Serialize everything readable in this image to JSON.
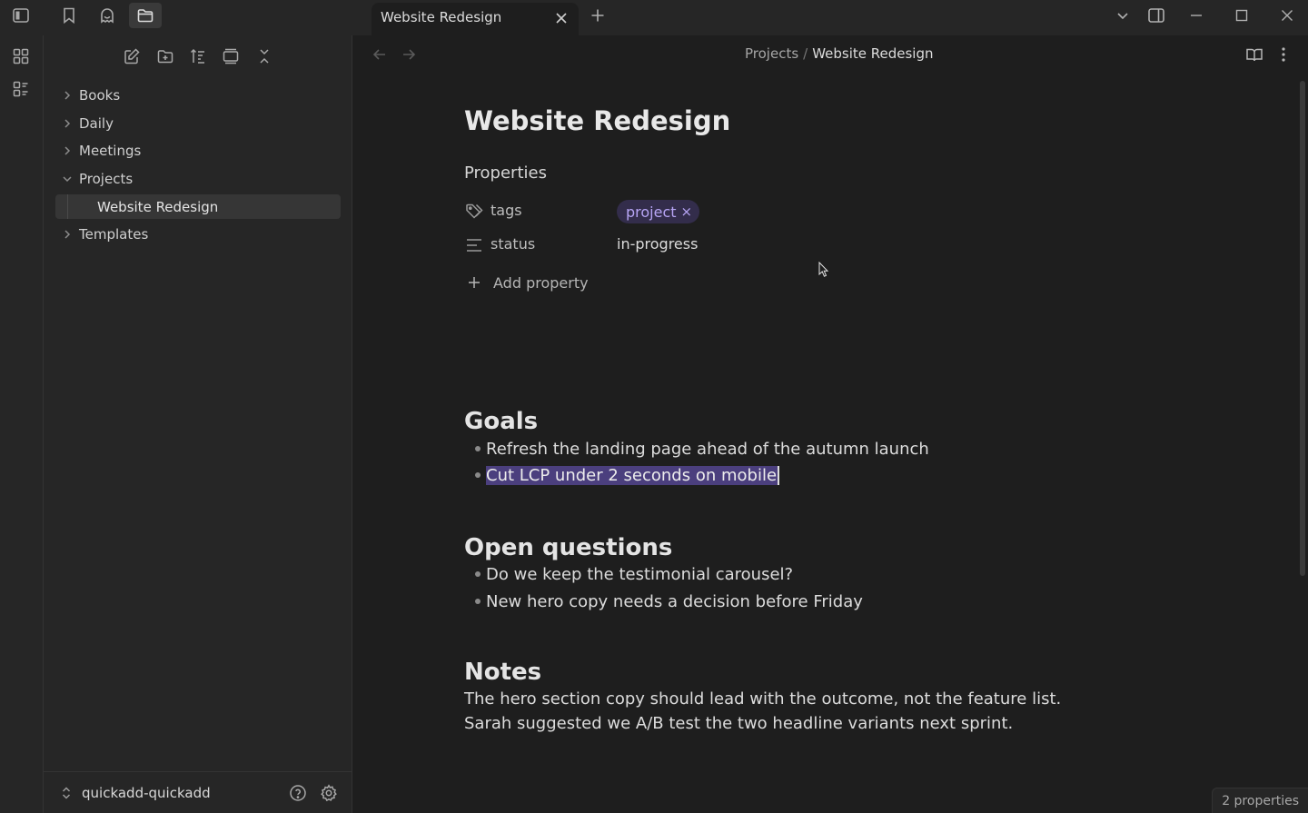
{
  "tabs": [
    {
      "label": "Website Redesign",
      "active": true
    }
  ],
  "sidebar": {
    "items": [
      {
        "label": "Books",
        "type": "folder",
        "expanded": false
      },
      {
        "label": "Daily",
        "type": "folder",
        "expanded": false
      },
      {
        "label": "Meetings",
        "type": "folder",
        "expanded": false
      },
      {
        "label": "Projects",
        "type": "folder",
        "expanded": true
      },
      {
        "label": "Website Redesign",
        "type": "file",
        "active": true
      },
      {
        "label": "Templates",
        "type": "folder",
        "expanded": false
      }
    ],
    "vault_name": "quickadd-quickadd"
  },
  "breadcrumb": {
    "parent": "Projects",
    "separator": "/",
    "current": "Website Redesign"
  },
  "note": {
    "title": "Website Redesign",
    "properties_heading": "Properties",
    "properties": [
      {
        "key": "tags",
        "icon": "tags-icon",
        "value": "project",
        "kind": "tag"
      },
      {
        "key": "status",
        "icon": "text-lines-icon",
        "value": "in-progress",
        "kind": "text"
      }
    ],
    "add_property_label": "Add property",
    "sections": {
      "goals": {
        "heading": "Goals",
        "bullets": [
          "Refresh the landing page ahead of the autumn launch",
          "Cut LCP under 2 seconds on mobile"
        ]
      },
      "questions": {
        "heading": "Open questions",
        "bullets": [
          "Do we keep the testimonial carousel?",
          "New hero copy needs a decision before Friday"
        ]
      },
      "notes": {
        "heading": "Notes",
        "paragraphs": [
          "The hero section copy should lead with the outcome, not the feature list.",
          "Sarah suggested we A/B test the two headline variants next sprint."
        ]
      }
    }
  },
  "tag_remove_glyph": "×",
  "status_bar": {
    "properties_count": "2 properties"
  },
  "colors": {
    "accent": "#b7a5f5",
    "tag_bg": "#332d4b",
    "selection": "#4b3f7e",
    "background": "#1e1e1e",
    "sidebar_bg": "#262626"
  }
}
